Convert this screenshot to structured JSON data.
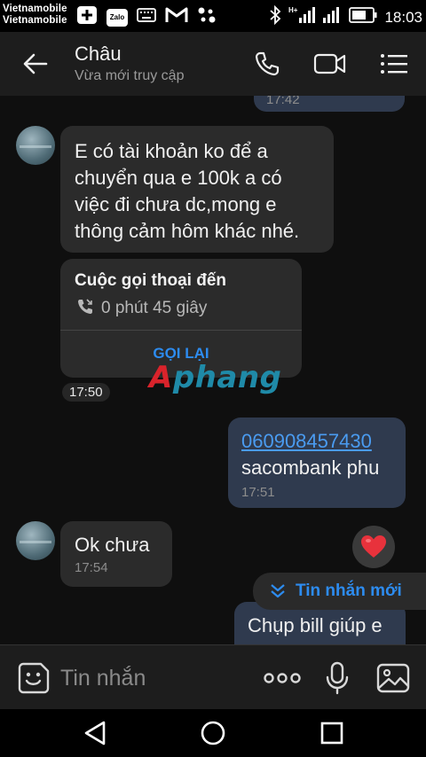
{
  "status_bar": {
    "carrier_1": "Vietnamobile",
    "carrier_2": "Vietnamobile",
    "zalo_label": "Zalo",
    "network": "H+",
    "time": "18:03",
    "icons": [
      "add-box-icon",
      "zalo-icon",
      "keyboard-icon",
      "gmail-icon",
      "dots-app-icon",
      "bluetooth-icon",
      "signal-icon",
      "battery-icon"
    ]
  },
  "header": {
    "contact_name": "Châu",
    "contact_status": "Vừa mới truy cập"
  },
  "chat": {
    "prev_time": "17:42",
    "messages": [
      {
        "direction": "incoming",
        "lines": [
          "E có tài khoản ko để a",
          "chuyển qua e 100k a có",
          "việc đi chưa dc,mong e",
          "thông cảm hôm khác nhé."
        ]
      },
      {
        "direction": "incoming",
        "type": "call",
        "title": "Cuộc gọi thoại đến",
        "duration": "0 phút 45 giây",
        "action": "GỌI LẠI",
        "time": "17:50"
      },
      {
        "direction": "outgoing",
        "link": "060908457430",
        "text": "sacombank phu",
        "time": "17:51"
      },
      {
        "direction": "incoming",
        "text": "Ok chưa",
        "time": "17:54",
        "reaction": "heart"
      },
      {
        "direction": "outgoing",
        "text": "Chụp bill giúp e"
      }
    ],
    "new_messages_label": "Tin nhắn mới",
    "watermark": {
      "first": "A",
      "rest": "phang"
    }
  },
  "input_bar": {
    "placeholder": "Tin nhắn"
  },
  "colors": {
    "accent": "#2d8cf0",
    "incoming_bubble": "#2b2b2b",
    "outgoing_bubble": "#2f3a4e",
    "header_bg": "#1d1d1d",
    "heart": "#e8323c"
  }
}
